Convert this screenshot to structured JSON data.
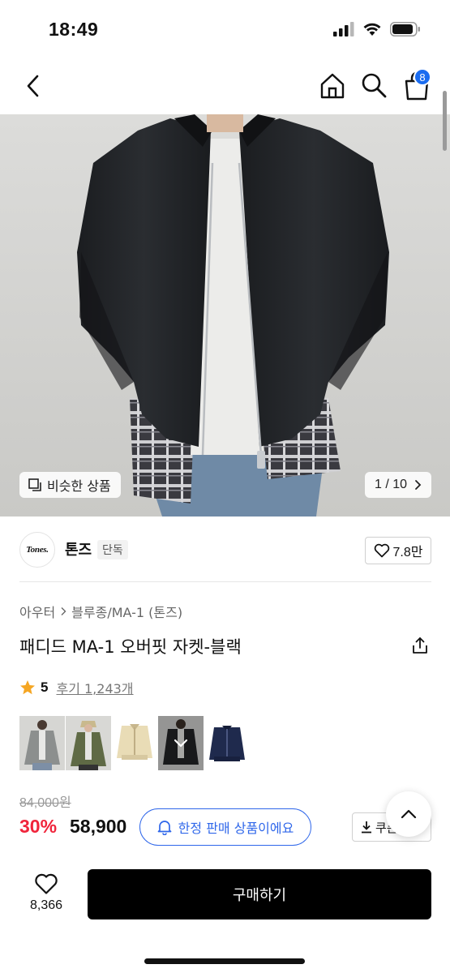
{
  "status": {
    "time": "18:49"
  },
  "nav": {
    "cart_count": "8"
  },
  "gallery": {
    "similar_label": "비슷한 상품",
    "counter": "1 / 10"
  },
  "brand": {
    "name": "톤즈",
    "logo_text": "Tones.",
    "tag": "단독",
    "likes": "7.8만"
  },
  "product": {
    "breadcrumb": [
      "아우터",
      "블루종/MA-1 (톤즈)"
    ],
    "title": "패디드 MA-1 오버핏 자켓-블랙",
    "rating": "5",
    "review_label": "후기 1,243개",
    "variants": [
      "charcoal",
      "khaki",
      "beige",
      "black",
      "navy"
    ],
    "selected_variant": "black"
  },
  "price": {
    "original": "84,000원",
    "discount": "30%",
    "sale": "58,900",
    "limited_notice": "한정 판매 상품이에요",
    "coupon_label": "쿠폰"
  },
  "bottom": {
    "wish_count": "8,366",
    "buy_label": "구매하기"
  },
  "colors": {
    "accent": "#2f67ea",
    "discount": "#f0243b",
    "badge": "#1a6cf0",
    "buy_bg": "#000000"
  }
}
